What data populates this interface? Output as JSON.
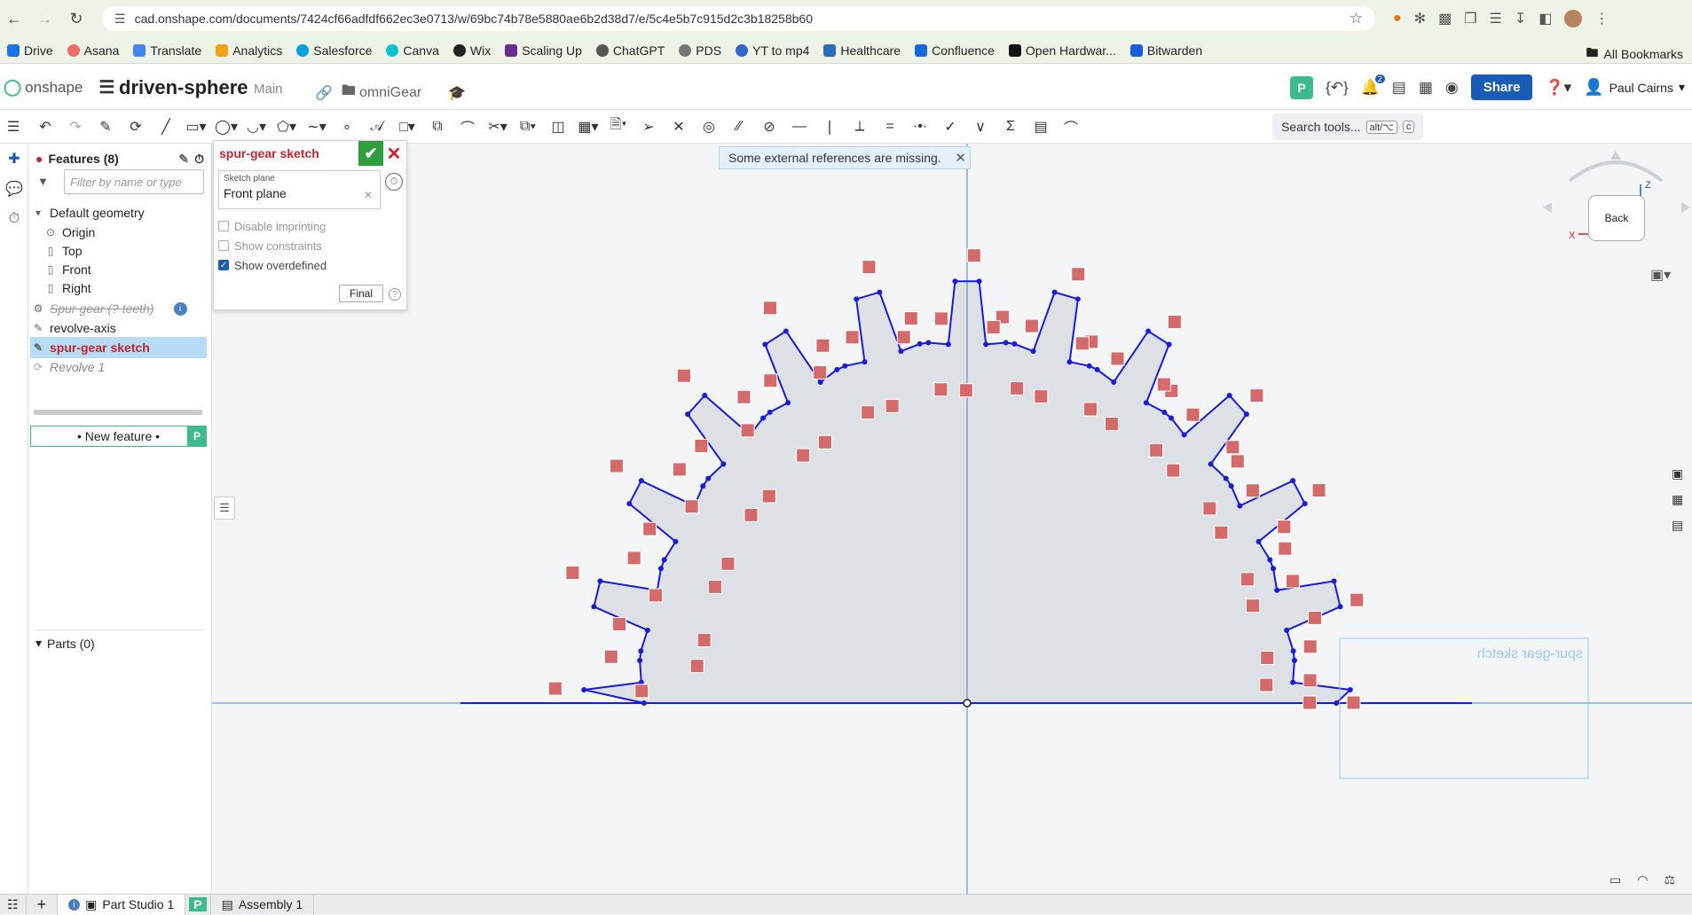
{
  "browser": {
    "url": "cad.onshape.com/documents/7424cf66adfdf662ec3e0713/w/69bc74b78e5880ae6b2d38d7/e/5c4e5b7c915d2c3b18258b60",
    "bookmarks": [
      "Drive",
      "Asana",
      "Translate",
      "Analytics",
      "Salesforce",
      "Canva",
      "Wix",
      "Scaling Up",
      "ChatGPT",
      "PDS",
      "YT to mp4",
      "Healthcare",
      "Confluence",
      "Open Hardwar...",
      "Bitwarden"
    ],
    "all_bookmarks": "All Bookmarks",
    "bookmark_colors": [
      "#1a73e8",
      "#f06a6a",
      "#4285f4",
      "#f4a21c",
      "#00a1e0",
      "#00c4cc",
      "#222222",
      "#6a2c91",
      "#555555",
      "#777777",
      "#3366cc",
      "#2a6dbf",
      "#1868db",
      "#111111",
      "#175ddc"
    ]
  },
  "header": {
    "logo": "onshape",
    "doc_title": "driven-sphere",
    "workspace": "Main",
    "folder": "omniGear",
    "notifications_count": "2",
    "share_label": "Share",
    "user_name": "Paul Cairns",
    "p_badge": "P"
  },
  "toolbar": {
    "search_label": "Search tools...",
    "search_key1": "alt/⌥",
    "search_key2": "c"
  },
  "features": {
    "title": "Features (8)",
    "filter_placeholder": "Filter by name or type",
    "default_geometry": "Default geometry",
    "origin": "Origin",
    "top": "Top",
    "front": "Front",
    "right": "Right",
    "spur_gear": "Spur gear (? teeth)",
    "revolve_axis": "revolve-axis",
    "spur_gear_sketch": "spur-gear sketch",
    "revolve1": "Revolve 1",
    "new_feature": "• New feature •",
    "new_feature_badge": "P",
    "parts": "Parts (0)"
  },
  "sketch_dialog": {
    "title": "spur-gear sketch",
    "plane_label": "Sketch plane",
    "plane_value": "Front plane",
    "disable_imprinting": "Disable imprinting",
    "show_constraints": "Show constraints",
    "show_overdefined": "Show overdefined",
    "show_overdefined_checked": true,
    "final_label": "Final"
  },
  "notice": {
    "text": "Some external references are missing."
  },
  "viewcube": {
    "face": "Back",
    "axis_x": "X",
    "axis_z": "Z"
  },
  "canvas": {
    "sketch_label": "spur-gear sketch",
    "tooth_count": 24,
    "profile_color": "#1a1adb",
    "constraint_color": "#d46a6a",
    "fill_color": "#dde1e6",
    "axis_color": "#4a7fc1"
  },
  "tabs": {
    "part_studio": "Part Studio 1",
    "assembly": "Assembly 1",
    "p_badge": "P"
  }
}
